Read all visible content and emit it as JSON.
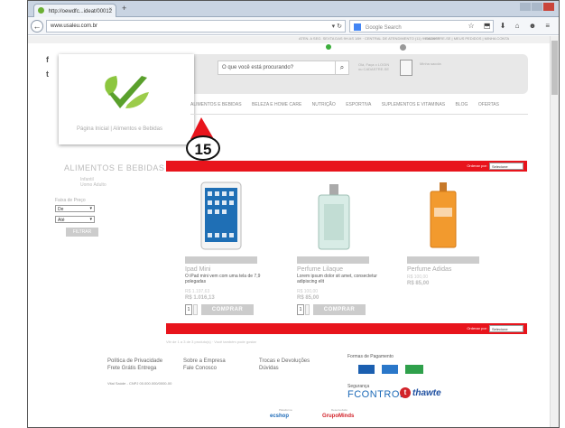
{
  "browser": {
    "tab_title": "http://oewdfc...ideat/00012",
    "tab_close": "×",
    "new_tab": "+",
    "url": "www.usaleu.com.br",
    "search_placeholder": "Google Search",
    "url_arrow": "▾ ↻",
    "search_icon": "⌕",
    "nav_icons": "☆ ⬒ ⬇ ⌂ ☻ ≡",
    "back_glyph": "←"
  },
  "site": {
    "top_links": "ATEN. A SEG. SEXTA DAS 9H AS 18H · CENTRAL DE ATENDIMENTO (11) 9999-9999",
    "top_links_right": "CADASTRE-SE | MEUS PEDIDOS | MINHA CONTA",
    "social_fb": "f",
    "social_tw": "t",
    "search_placeholder": "O que você está procurando?",
    "search_button": "⌕",
    "cart_line1": "Olá, Faça o LOGIN",
    "cart_line2": "ou CADASTRE-SE",
    "bag_text": "Minha sacola",
    "menu": [
      "ALIMENTOS E BEBIDAS",
      "BELEZA E HOME CARE",
      "NUTRIÇÃO",
      "ESPORTIVA",
      "SUPLEMENTOS E VITAMINAS",
      "BLOG",
      "OFERTAS"
    ],
    "marker_number": "15",
    "breadcrumb_home": "Página Inicial",
    "breadcrumb_sep": "|",
    "breadcrumb_current": "Alimentos e Bebidas",
    "category_title": "ALIMENTOS E BEBIDAS",
    "category_links": [
      "Infantil",
      "Uomo Adulto"
    ],
    "price_filter_label": "Faixa de Preço",
    "price_from": "De",
    "price_to": "Até",
    "filter_button": "FILTRAR",
    "order_label": "Ordenar por:",
    "order_value": "Selecione",
    "dropdown_arrow": "▾",
    "qty_value": "1",
    "buy_label": "COMPRAR"
  },
  "products": [
    {
      "name": "Ipad Mini",
      "desc": "O iPad mini vem com uma tela de 7,9 polegadas",
      "old_price": "R$ 1.197,63",
      "new_price": "R$ 1.016,13"
    },
    {
      "name": "Perfume Lilaque",
      "desc": "Lorem ipsum dolor sit amet, consectetur adipiscing elit",
      "old_price": "R$ 100,00",
      "new_price": "R$ 85,00"
    },
    {
      "name": "Perfume Adidas",
      "desc": "",
      "old_price": "R$ 100,00",
      "new_price": "R$ 85,00"
    }
  ],
  "footer": {
    "note": "Vitr de 1 a 3 de 3 produto(s) · Você também pode gostar",
    "col1": [
      "Política de Privacidade",
      "Frete Grátis Entrega"
    ],
    "col2": [
      "Sobre a Empresa",
      "Fale Conosco"
    ],
    "col3": [
      "Trocas e Devoluções",
      "Dúvidas"
    ],
    "cnpj": "Vital Saúde - CNPJ 00.000.000/0000-00",
    "pay_title": "Formas de Pagamento",
    "sec_title": "Segurança",
    "fcontrol": "FCONTROL",
    "thawte": "thawte",
    "thawte_mark": "t",
    "platform_label": "Plataforma",
    "platform_name": "ecshop",
    "dev_label": "Desenvolvido",
    "dev_name": "GrupoMinds"
  },
  "colors": {
    "brand_green": "#6bb034",
    "brand_red": "#e8141c"
  }
}
